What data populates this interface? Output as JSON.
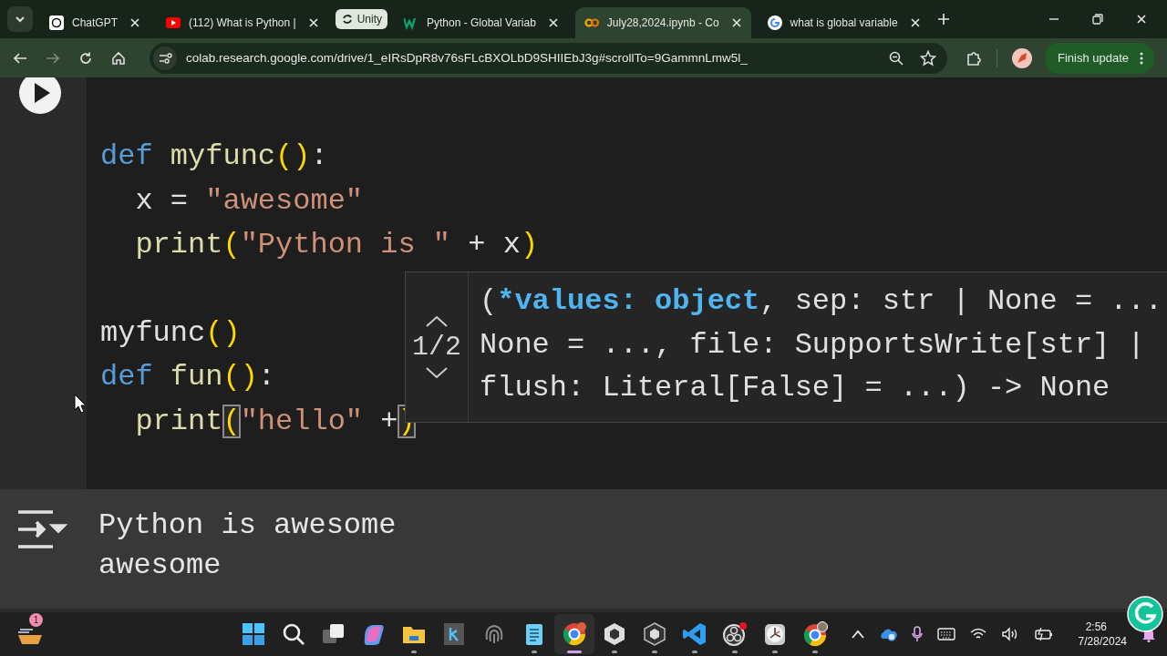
{
  "browser": {
    "tabs": [
      {
        "kind": "tab",
        "title": "ChatGPT",
        "selected": false
      },
      {
        "kind": "tab",
        "title": "(112) What is Python |",
        "selected": false
      },
      {
        "kind": "group",
        "title": "Unity"
      },
      {
        "kind": "tab",
        "title": "Python - Global Variab",
        "selected": false
      },
      {
        "kind": "tab",
        "title": "July28,2024.ipynb - Co",
        "selected": true
      },
      {
        "kind": "tab",
        "title": "what is global variable",
        "selected": false
      }
    ],
    "address": "colab.research.google.com/drive/1_eIRsDpR8v76sFLcBXOLbD9SHIIEbJ3g#scrollTo=9GammnLmw5l_",
    "update_button": "Finish update"
  },
  "cell": {
    "lines": [
      {
        "kind": "code",
        "indented": false,
        "tokens": [
          {
            "kind": "keyword",
            "text": "def"
          },
          {
            "kind": "function",
            "text": " myfunc"
          },
          {
            "kind": "paren",
            "text": "()"
          },
          {
            "kind": "plain",
            "text": ":"
          }
        ]
      },
      {
        "kind": "code",
        "indented": true,
        "tokens": [
          {
            "kind": "plain",
            "text": "x = "
          },
          {
            "kind": "string",
            "text": "\"awesome\""
          }
        ]
      },
      {
        "kind": "code",
        "indented": true,
        "tokens": [
          {
            "kind": "function",
            "text": "print"
          },
          {
            "kind": "paren",
            "text": "("
          },
          {
            "kind": "string",
            "text": "\"Python is \""
          },
          {
            "kind": "plain",
            "text": " + x"
          },
          {
            "kind": "paren",
            "text": ")"
          }
        ]
      },
      {
        "kind": "blank"
      },
      {
        "kind": "code",
        "indented": false,
        "tokens": [
          {
            "kind": "plain",
            "text": "myfunc"
          },
          {
            "kind": "paren",
            "text": "()"
          }
        ]
      },
      {
        "kind": "code",
        "indented": false,
        "tokens": [
          {
            "kind": "keyword",
            "text": "def"
          },
          {
            "kind": "function",
            "text": " fun"
          },
          {
            "kind": "paren",
            "text": "()"
          },
          {
            "kind": "plain",
            "text": ":"
          }
        ]
      },
      {
        "kind": "code",
        "indented": true,
        "tokens": [
          {
            "kind": "function",
            "text": "print"
          },
          {
            "kind": "match",
            "text": "("
          },
          {
            "kind": "string",
            "text": "\"hello\""
          },
          {
            "kind": "plain",
            "text": " +"
          },
          {
            "kind": "match",
            "text": ")"
          }
        ]
      }
    ],
    "signature_help": {
      "counter": "1/2",
      "lines": [
        [
          {
            "kind": "plain",
            "text": "("
          },
          {
            "kind": "param",
            "text": "*values: object"
          },
          {
            "kind": "plain",
            "text": ", sep: str | None = ..."
          }
        ],
        [
          {
            "kind": "plain",
            "text": "None = ..., file: SupportsWrite[str] |"
          }
        ],
        [
          {
            "kind": "plain",
            "text": "flush: Literal[False] = ...) -> None"
          }
        ]
      ]
    },
    "output": [
      "Python is awesome",
      "awesome"
    ]
  },
  "taskbar": {
    "widget_badge": "1",
    "apps": [
      {
        "running": false,
        "selected": false
      },
      {
        "running": false,
        "selected": false
      },
      {
        "running": false,
        "selected": false
      },
      {
        "running": false,
        "selected": false
      },
      {
        "running": true,
        "selected": false
      },
      {
        "running": false,
        "selected": false
      },
      {
        "running": false,
        "selected": false
      },
      {
        "running": true,
        "selected": false
      },
      {
        "running": true,
        "selected": true
      },
      {
        "running": true,
        "selected": false
      },
      {
        "running": true,
        "selected": false
      },
      {
        "running": true,
        "selected": false
      },
      {
        "running": true,
        "selected": false
      },
      {
        "running": true,
        "selected": false
      },
      {
        "running": true,
        "selected": false
      }
    ],
    "time": "2:56",
    "date": "7/28/2024"
  }
}
